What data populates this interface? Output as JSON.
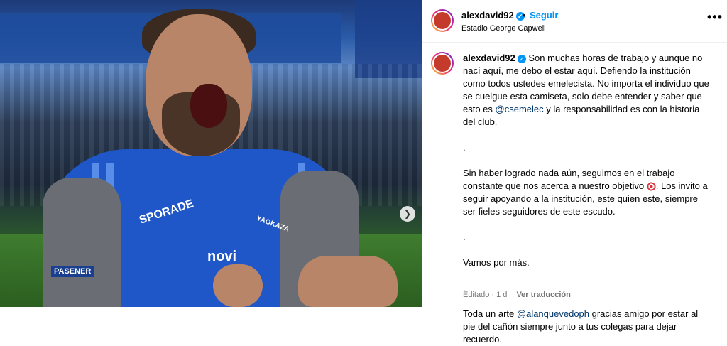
{
  "post": {
    "username": "alexdavid92",
    "follow_label": "Seguir",
    "location": "Estadio George Capwell",
    "dot": "•"
  },
  "media": {
    "sponsors": {
      "chest": "novi",
      "sleeve_left": "SPORADE",
      "lower_left": "PASENER",
      "sleeve_right": "YAOKAZA"
    }
  },
  "caption": {
    "username": "alexdavid92",
    "paragraphs": [
      {
        "text_before": "Son muchas horas de trabajo y aunque no nací aquí, me debo el estar aquí. Defiendo la institución como todos ustedes emelecista. No importa el individuo que se cuelgue esta camiseta, solo debe entender y saber que esto es ",
        "mention": "@csemelec",
        "text_after": " y la responsabilidad es con la historia del club."
      },
      {
        "text": "."
      },
      {
        "text_before": "Sin haber logrado nada aún, seguimos en el trabajo constante que nos acerca a nuestro objetivo ",
        "text_after": ". Los invito a seguir apoyando a la institución, este quien este, siempre ser fieles seguidores de este escudo."
      },
      {
        "text": "."
      },
      {
        "text": "Vamos por más."
      },
      {
        "text": "."
      },
      {
        "text_before": "Toda un arte ",
        "mention": "@alanquevedoph",
        "text_after": " gracias amigo por estar al pie del cañón siempre junto a tus colegas para dejar recuerdo."
      }
    ]
  },
  "meta": {
    "edited": "Editado · 1 d",
    "see_translation": "Ver traducción"
  },
  "icons": {
    "verified": "verified-badge-icon",
    "more": "more-options-icon",
    "next": "chevron-right-icon",
    "target": "target-emoji-icon"
  },
  "colors": {
    "link_blue": "#0095f6",
    "mention": "#00376b",
    "muted": "#737373"
  }
}
